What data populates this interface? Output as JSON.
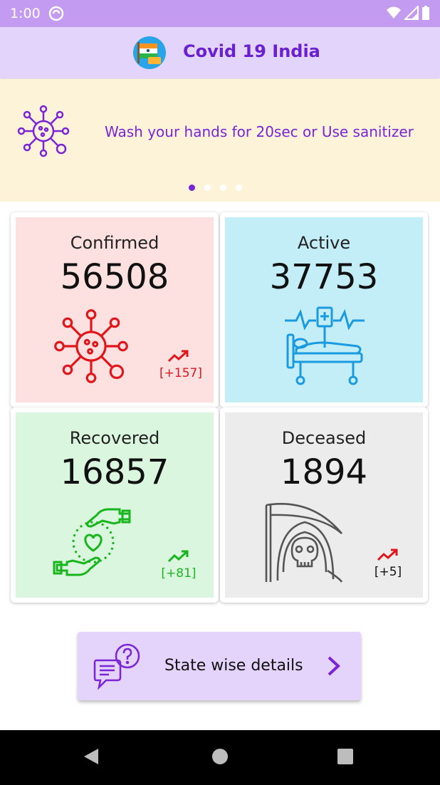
{
  "status_bar": {
    "time": "1:00"
  },
  "app_bar": {
    "title": "Covid 19 India"
  },
  "banner": {
    "message": "Wash your hands for 20sec or Use sanitizer",
    "page_count": 4,
    "active_page": 1
  },
  "stats": [
    {
      "label": "Confirmed",
      "value": "56508",
      "delta": "[+157]",
      "color": "#e0161b",
      "bg": "#fde0e0"
    },
    {
      "label": "Active",
      "value": "37753",
      "bg": "#c3eef8",
      "icon_color": "#1a9be0"
    },
    {
      "label": "Recovered",
      "value": "16857",
      "delta": "[+81]",
      "color": "#19b51c",
      "bg": "#daf6df"
    },
    {
      "label": "Deceased",
      "value": "1894",
      "delta": "[+5]",
      "color": "#e0161b",
      "bg": "#ececec"
    }
  ],
  "state_button": {
    "label": "State wise details"
  },
  "colors": {
    "accent": "#7a24d6",
    "status_bar": "#c39bf0",
    "app_bar": "#e3d4fb",
    "banner": "#fcf3d9"
  },
  "icons": [
    "wifi-icon",
    "signal-icon",
    "battery-icon",
    "virus-icon",
    "hospital-bed-icon",
    "caring-hands-icon",
    "grim-reaper-icon",
    "trend-up-icon",
    "chat-question-icon",
    "chevron-right-icon",
    "back-icon",
    "home-icon",
    "recents-icon"
  ]
}
